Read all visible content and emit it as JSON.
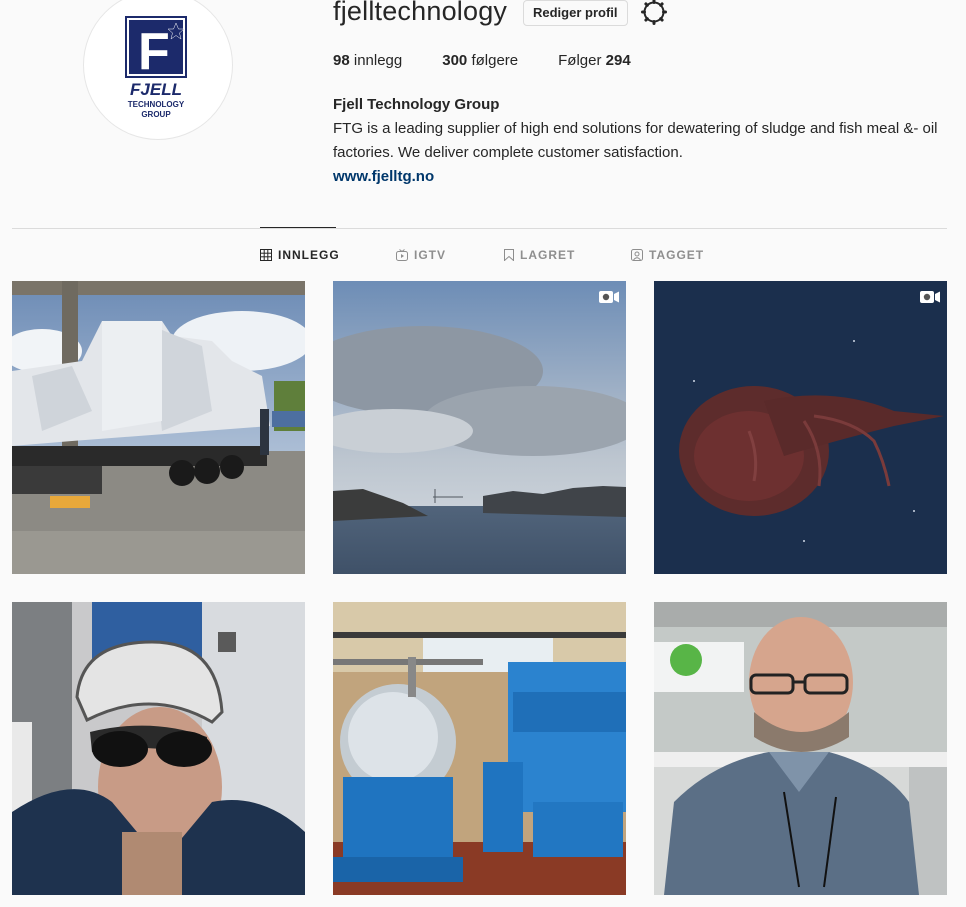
{
  "profile": {
    "username": "fjelltechnology",
    "edit_label": "Rediger profil",
    "logo_text": "F",
    "logo_line1": "FJELL",
    "logo_line2": "TECHNOLOGY",
    "logo_line3": "GROUP"
  },
  "stats": {
    "posts_count": "98",
    "posts_label": "innlegg",
    "followers_count": "300",
    "followers_label": "følgere",
    "following_label": "Følger",
    "following_count": "294"
  },
  "bio": {
    "name": "Fjell Technology Group",
    "text": "FTG is a leading supplier of high end solutions for dewatering of sludge and fish meal &- oil factories. We deliver complete customer satisfaction.",
    "link": "www.fjelltg.no"
  },
  "tabs": [
    {
      "label": "INNLEGG",
      "icon": "grid-icon",
      "active": true
    },
    {
      "label": "IGTV",
      "icon": "igtv-icon",
      "active": false
    },
    {
      "label": "LAGRET",
      "icon": "bookmark-icon",
      "active": false
    },
    {
      "label": "TAGGET",
      "icon": "tag-icon",
      "active": false
    }
  ],
  "posts": [
    {
      "subject": "truck-with-wrapped-machinery",
      "video": false
    },
    {
      "subject": "fjord-bridge-landscape",
      "video": true
    },
    {
      "subject": "deep-sea-creature",
      "video": true
    },
    {
      "subject": "cyclist-selfie",
      "video": false
    },
    {
      "subject": "blue-industrial-machinery",
      "video": false
    },
    {
      "subject": "man-portrait",
      "video": false
    }
  ],
  "colors": {
    "logo_blue": "#1c2a6b",
    "link_color": "#00376b",
    "background": "#fafafa"
  }
}
